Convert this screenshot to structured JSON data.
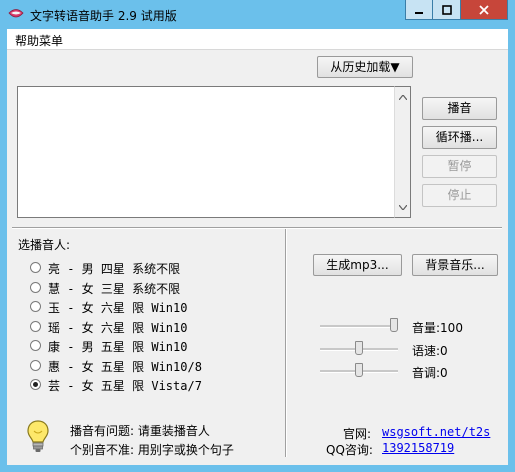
{
  "window": {
    "title": "文字转语音助手 2.9 试用版",
    "controls": {
      "minimize": "minimize-icon",
      "maximize": "maximize-icon",
      "close": "close-icon"
    }
  },
  "menu": {
    "items": [
      "帮助菜单"
    ]
  },
  "history_button": "从历史加载▼",
  "text_input": {
    "value": ""
  },
  "playback": {
    "play": "播音",
    "loop": "循环播...",
    "pause": "暂停",
    "stop": "停止"
  },
  "speakers": {
    "label": "选播音人:",
    "options": [
      {
        "text": "亮  - 男  四星  系统不限",
        "selected": false
      },
      {
        "text": "慧  - 女  三星  系统不限",
        "selected": false
      },
      {
        "text": "玉  - 女  六星  限 Win10",
        "selected": false
      },
      {
        "text": "瑶  - 女  六星  限 Win10",
        "selected": false
      },
      {
        "text": "康  - 男  五星  限 Win10",
        "selected": false
      },
      {
        "text": "惠  - 女  五星  限 Win10/8",
        "selected": false
      },
      {
        "text": "芸  - 女  五星  限 Vista/7",
        "selected": true
      }
    ]
  },
  "actions": {
    "mp3": "生成mp3...",
    "bgm": "背景音乐..."
  },
  "sliders": {
    "volume": {
      "label": "音量:100",
      "value": 100,
      "min": 0,
      "max": 100
    },
    "speed": {
      "label": "语速:0",
      "value": 0,
      "min": -10,
      "max": 10
    },
    "pitch": {
      "label": "音调:0",
      "value": 0,
      "min": -10,
      "max": 10
    }
  },
  "hints": {
    "line1": "播音有问题: 请重装播音人",
    "line2": "个别音不准: 用别字或换个句子"
  },
  "footer": {
    "site_label": "官网:",
    "site_link": "wsgsoft.net/t2s",
    "qq_label": "QQ咨询:",
    "qq_number": "1392158719"
  },
  "colors": {
    "titlebar": "#6bc0eb",
    "close_button": "#c7463a",
    "link": "#0000ee"
  }
}
